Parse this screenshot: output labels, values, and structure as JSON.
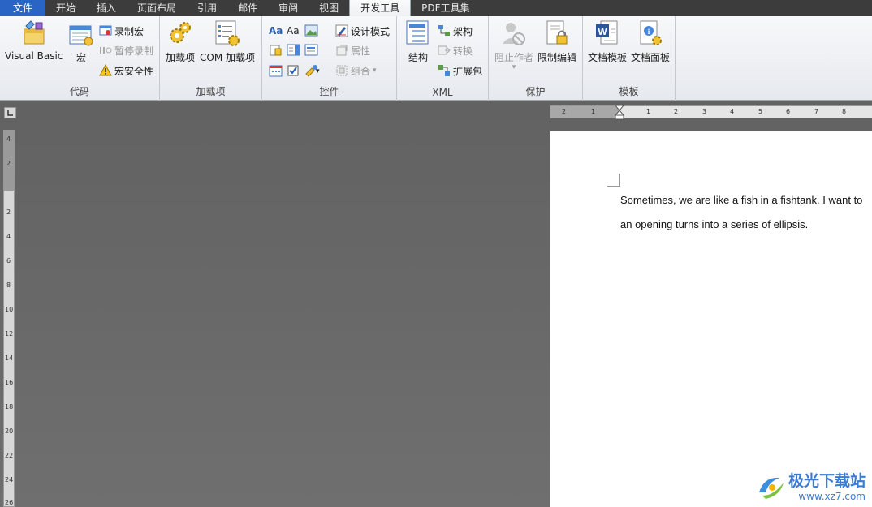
{
  "tabs": [
    {
      "label": "文件",
      "type": "file"
    },
    {
      "label": "开始"
    },
    {
      "label": "插入"
    },
    {
      "label": "页面布局"
    },
    {
      "label": "引用"
    },
    {
      "label": "邮件"
    },
    {
      "label": "审阅"
    },
    {
      "label": "视图"
    },
    {
      "label": "开发工具",
      "active": true
    },
    {
      "label": "PDF工具集"
    }
  ],
  "ribbon": {
    "code": {
      "label": "代码",
      "visual_basic": "Visual Basic",
      "macro": "宏",
      "record_macro": "录制宏",
      "pause_record": "暂停录制",
      "macro_security": "宏安全性"
    },
    "addins": {
      "label": "加载项",
      "addins": "加载项",
      "com_addins": "COM 加载项"
    },
    "controls": {
      "label": "控件",
      "design_mode": "设计模式",
      "properties": "属性",
      "group": "组合",
      "aa1": "Aa",
      "aa2": "Aa"
    },
    "xml": {
      "label": "XML",
      "structure": "结构",
      "schema": "架构",
      "transform": "转换",
      "expansion_pack": "扩展包"
    },
    "protect": {
      "label": "保护",
      "block_authors": "阻止作者",
      "restrict_editing": "限制编辑"
    },
    "templates": {
      "label": "模板",
      "document_template": "文档模板",
      "document_panel": "文档面板"
    }
  },
  "ruler": {
    "h_ticks": [
      "2",
      "1",
      "1",
      "2",
      "3",
      "4",
      "5",
      "6",
      "7",
      "8"
    ],
    "v_ticks": [
      "4",
      "2",
      "2",
      "4",
      "6",
      "8",
      "10",
      "12",
      "14",
      "16",
      "18",
      "20",
      "22",
      "24",
      "26"
    ]
  },
  "document": {
    "line1": "Sometimes, we are like a fish in a fishtank. I want to",
    "line2": "an opening turns into a series of ellipsis."
  },
  "watermark": {
    "title": "极光下载站",
    "url": "www.xz7.com"
  }
}
